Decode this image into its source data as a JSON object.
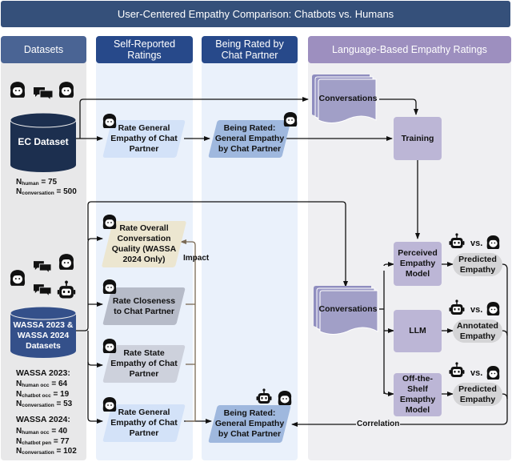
{
  "title": "User-Centered Empathy Comparison: Chatbots vs. Humans",
  "columns": {
    "datasets": "Datasets",
    "self_reported": "Self-Reported Ratings",
    "being_rated": "Being Rated by Chat Partner",
    "language_based": "Language-Based Empathy Ratings"
  },
  "ec": {
    "cylinder_label": "EC Dataset",
    "stats": [
      {
        "n": "N",
        "sub": "human",
        "value": "= 75"
      },
      {
        "n": "N",
        "sub": "conversation",
        "value": "= 500"
      }
    ],
    "self_rating": "Rate General Empathy of Chat Partner",
    "being_rated": "Being Rated: General Empathy by Chat Partner"
  },
  "wassa": {
    "cylinder_label": "WASSA 2023 & WASSA 2024 Datasets",
    "groups": [
      {
        "heading": "WASSA 2023:",
        "stats": [
          {
            "n": "N",
            "sub": "human occ",
            "value": "= 64"
          },
          {
            "n": "N",
            "sub": "chatbot occ",
            "value": "= 19"
          },
          {
            "n": "N",
            "sub": "conversation",
            "value": "= 53"
          }
        ]
      },
      {
        "heading": "WASSA 2024:",
        "stats": [
          {
            "n": "N",
            "sub": "human occ",
            "value": "= 40"
          },
          {
            "n": "N",
            "sub": "chatbot pen",
            "value": "= 77"
          },
          {
            "n": "N",
            "sub": "conversation",
            "value": "= 102"
          }
        ]
      }
    ],
    "self_ratings": [
      "Rate Overall Conversation Quality (WASSA 2024 Only)",
      "Rate Closeness to Chat Partner",
      "Rate State Empathy of Chat Partner",
      "Rate General Empathy of Chat Partner"
    ],
    "being_rated": "Being Rated: General Empathy by Chat Partner",
    "impact_label": "Impact",
    "correlation_label": "Correlation"
  },
  "language": {
    "conversations_top": "Conversations",
    "training": "Training",
    "conversations_bottom": "Conversations",
    "models": [
      {
        "name": "Perceived Empathy Model",
        "output": "Predicted Empathy"
      },
      {
        "name": "LLM",
        "output": "Annotated Empathy"
      },
      {
        "name": "Off-the-Shelf Emapthy Model",
        "output": "Predicted Empathy"
      }
    ],
    "vs_label": "vs."
  },
  "colors": {
    "title_bg": "#35507a",
    "datasets_head": "#4a6494",
    "self_head": "#27498a",
    "lang_head": "#9d8fbf",
    "ec_cylinder": "#1c2f4f",
    "wassa_cylinder": "#34508a",
    "light_blue_para": "#d3e2f8",
    "mid_blue_para": "#9fb8de",
    "beige_para": "#ece6d0",
    "gray_para": "#b6bbc8",
    "lightgray_para": "#cdd1dc",
    "node_purple": "#bcb6d6",
    "conv_purple": "#a19fc7",
    "impact_line": "#7a6a55"
  }
}
